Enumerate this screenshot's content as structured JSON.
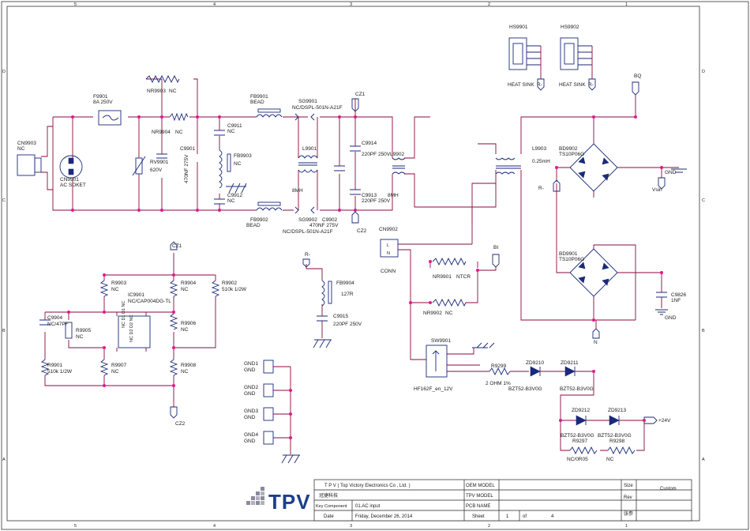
{
  "frame": {
    "cols": [
      "5",
      "4",
      "3",
      "2",
      "1"
    ],
    "rows": [
      "D",
      "C",
      "B",
      "A"
    ]
  },
  "labels": {
    "cn9903": "CN9903",
    "cn9903_nc": "NC",
    "cn9901": "CN9901",
    "cn9901_val": "AC SOKET",
    "f9901": "F9901",
    "f9901_val": "8A 250V",
    "nr9903": "NR9903",
    "nr9903_nc": "NC",
    "nr9904": "NR9904",
    "nr9904_nc": "NC",
    "rv9901": "RV9901",
    "rv9901_val": "620V",
    "c9901": "C9901",
    "c9901_val": "470NF 275V",
    "c9911": "C9911",
    "c9911_nc": "NC",
    "c9912": "C9912",
    "c9912_nc": "NC",
    "fb9903": "FB9903",
    "fb9903_nc": "NC",
    "fb9901": "FB9901",
    "fb9901_val": "BEAD",
    "fb9902": "FB9902",
    "fb9902_val": "BEAD",
    "sg9901": "SG9901",
    "sg9901_val": "NC/DSPL-501N-A21F",
    "sg9902": "SG9902",
    "sg9902_val": "NC/DSPL-501N-A21F",
    "l9901": "L9901",
    "l9901_val": "8MH",
    "c9902": "C9902",
    "c9902_val": "470NF 275V",
    "cz1_a": "CZ1",
    "cz2_a": "CZ2",
    "c9914": "C9914",
    "c9914_val": "220PF 250V",
    "c9913": "C9913",
    "c9913_val": "220PF 250V",
    "l9902": "L9902",
    "l9902_val": "8MH",
    "l9903": "L9903",
    "l9903_val": "0.25mH",
    "hs9901": "HS9901",
    "hs9902": "HS9902",
    "heat_sink_1": "HEAT SINK",
    "heat_sink_2": "HEAT SINK",
    "r_minus_1": "R-",
    "r_minus_2": "R-",
    "r_minus_3": "R-",
    "r_minus_4": "R-",
    "bq": "BQ",
    "bd9902": "BD9902",
    "bd9902_val": "TS10P06G",
    "bd9901": "BD9901",
    "bd9901_val": "TS10P06G",
    "vsin": "Vsin",
    "bi": "BI",
    "n": "N",
    "gnd_sym": "GND",
    "c9826": "C9826",
    "c9826_val": "1NF",
    "cn9902": "CN9902",
    "conn": "CONN",
    "nr9901": "NR9901",
    "ntcr": "NTCR",
    "nr9902": "NR9902",
    "nr9902_nc": "NC",
    "sw9901": "SW9901",
    "sw9901_val": "HF162F_en_12V",
    "r9299": "R9299",
    "r9299_val": "2 OHM 1%",
    "zd9210": "ZD9210",
    "zd9210_val": "BZT52-B3V0G",
    "zd9211": "ZD9211",
    "zd9211_val": "BZT52-B3V0G",
    "zd9212": "ZD9212",
    "zd9212_val": "BZT52-B3V0G",
    "zd9213": "ZD9213",
    "zd9213_val": "BZT52-B3V0G",
    "r9297": "R9297",
    "r9297_val": "NC/0R05",
    "r9298": "R9298",
    "r9298_val": "NC",
    "plus24": "+24V",
    "cz1_b": "CZ1",
    "cz2_b": "CZ2",
    "r9903": "R9903",
    "r9903_nc": "NC",
    "r9904": "R9904",
    "r9904_nc": "NC",
    "r9902": "R9902",
    "r9902_val": "510k 1/2W",
    "ic9901": "IC9901",
    "ic9901_val": "NC/CAP004DG-TL",
    "ic_pins_top": "NC D1 D1 NC",
    "ic_pins_bot": "NC D2 D2 NC",
    "c9904": "C9904",
    "c9904_val": "NC/47PF",
    "r9905": "R9905",
    "r9905_nc": "NC",
    "r9906": "R9906",
    "r9906_nc": "NC",
    "r9901": "R9901",
    "r9901_val": "510k 1/2W",
    "r9907": "R9907",
    "r9907_nc": "NC",
    "r9908": "R9908",
    "r9908_nc": "NC",
    "fb9904": "FB9904",
    "fb9904_val": "127R",
    "c9915": "C9915",
    "c9915_val": "220PF 250V",
    "gnd1": "GND1",
    "gnd2": "GND2",
    "gnd3": "GND3",
    "gnd4": "GND4",
    "gnd": "GND"
  },
  "title_block": {
    "company": "T P V  ( Top   Victory   Electronics   Co ,   Ltd. )",
    "company_cn": "冠捷科技",
    "oem_model_label": "OEM MODEL",
    "tpv_model_label": "TPV MODEL",
    "key_component_label": "Key Component",
    "key_component_value": "01.AC input",
    "pcb_name_label": "PCB NAME",
    "date_label": "Date",
    "date_value": "Friday, December 26, 2014",
    "sheet_label": "Sheet",
    "sheet_value": "1",
    "of_label": "of",
    "sheet_total": "4",
    "size_label": "Size",
    "size_value": "Custom",
    "rev_label": "Rev",
    "logo_text": "TPV",
    "chinese_mark": "张参"
  }
}
